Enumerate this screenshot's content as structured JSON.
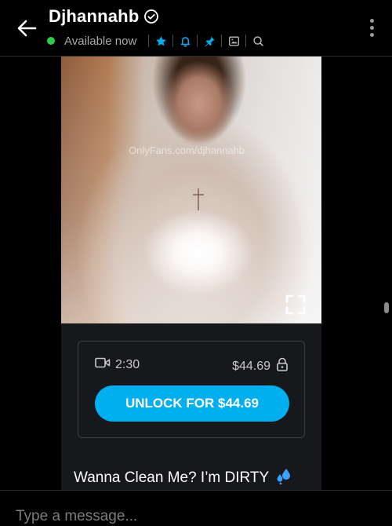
{
  "header": {
    "name": "Djhannahb",
    "status": "Available now",
    "icons": [
      "back-arrow-icon",
      "verified-icon",
      "star-icon",
      "bell-icon",
      "pin-icon",
      "image-icon",
      "search-icon",
      "more-icon"
    ],
    "colors": {
      "online": "#2ecc4e",
      "accent": "#00aff0"
    }
  },
  "message": {
    "watermark": "OnlyFans.com/djhannahb",
    "duration": "2:30",
    "price": "$44.69",
    "unlock_label": "UNLOCK FOR $44.69",
    "caption": "Wanna Clean Me? I’m DIRTY",
    "caption_emoji": "sweat-droplets-icon"
  },
  "composer": {
    "placeholder": "Type a message..."
  }
}
